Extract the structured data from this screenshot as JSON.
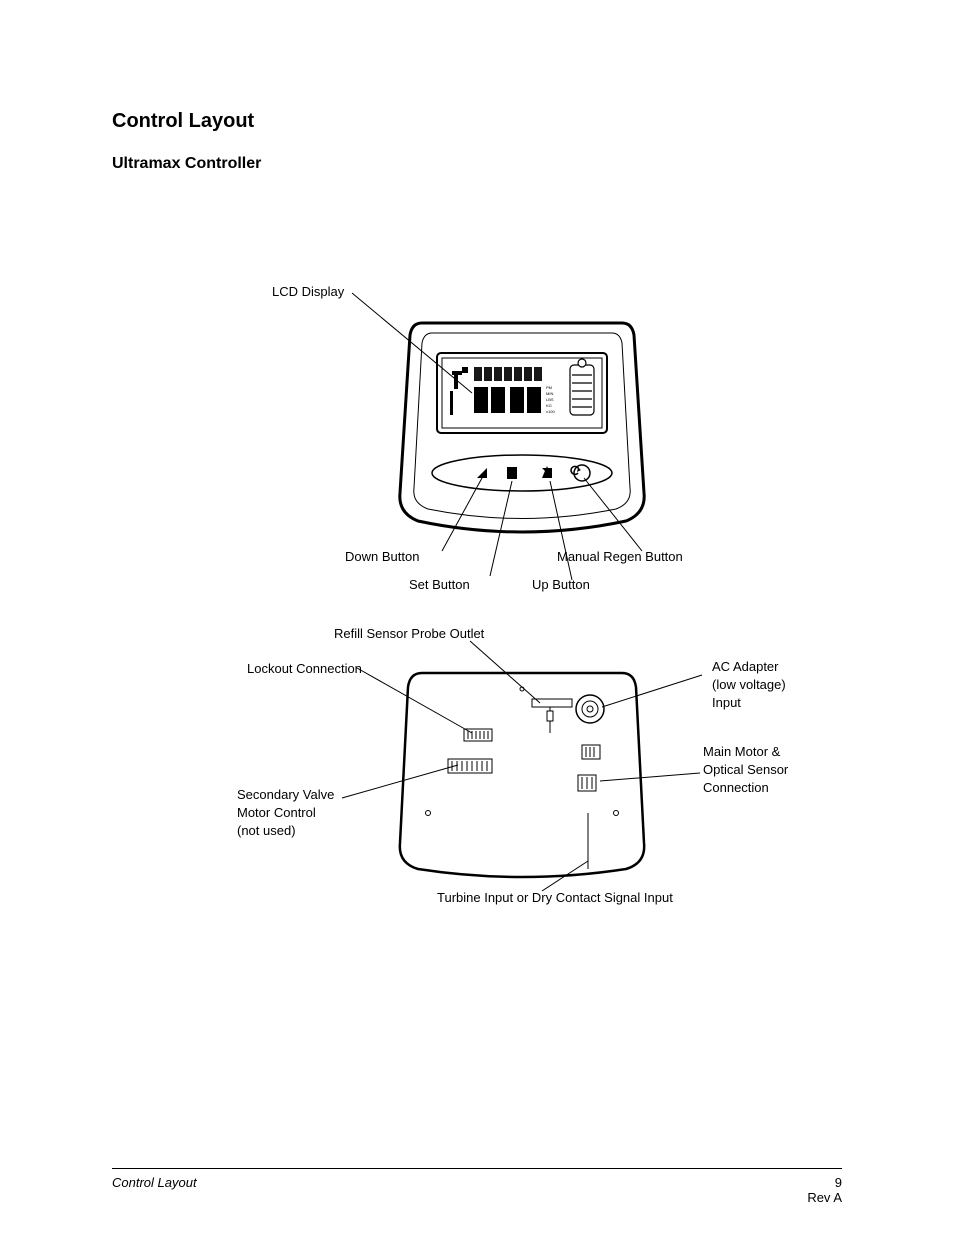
{
  "heading": "Control Layout",
  "subheading": "Ultramax Controller",
  "labels": {
    "lcd_display": "LCD Display",
    "down_button": "Down Button",
    "set_button": "Set Button",
    "up_button": "Up Button",
    "manual_regen": "Manual Regen Button",
    "refill_sensor": "Refill Sensor Probe Outlet",
    "lockout": "Lockout Connection",
    "ac_adapter_l1": "AC Adapter",
    "ac_adapter_l2": "(low voltage)",
    "ac_adapter_l3": "Input",
    "main_motor_l1": "Main Motor &",
    "main_motor_l2": "Optical Sensor",
    "main_motor_l3": "Connection",
    "secondary_l1": "Secondary Valve",
    "secondary_l2": "Motor Control",
    "secondary_l3": "(not used)",
    "turbine": "Turbine Input or Dry Contact Signal Input",
    "lcd_units_pm": "PM",
    "lcd_units_min": "MIN",
    "lcd_units_lbs": "LBS",
    "lcd_units_kg": "KG",
    "lcd_units_x100": "x100",
    "lcd_digits": "88:88",
    "lcd_digits_small": "8888888"
  },
  "footer": {
    "section": "Control Layout",
    "page_num": "9",
    "revision": "Rev A"
  }
}
